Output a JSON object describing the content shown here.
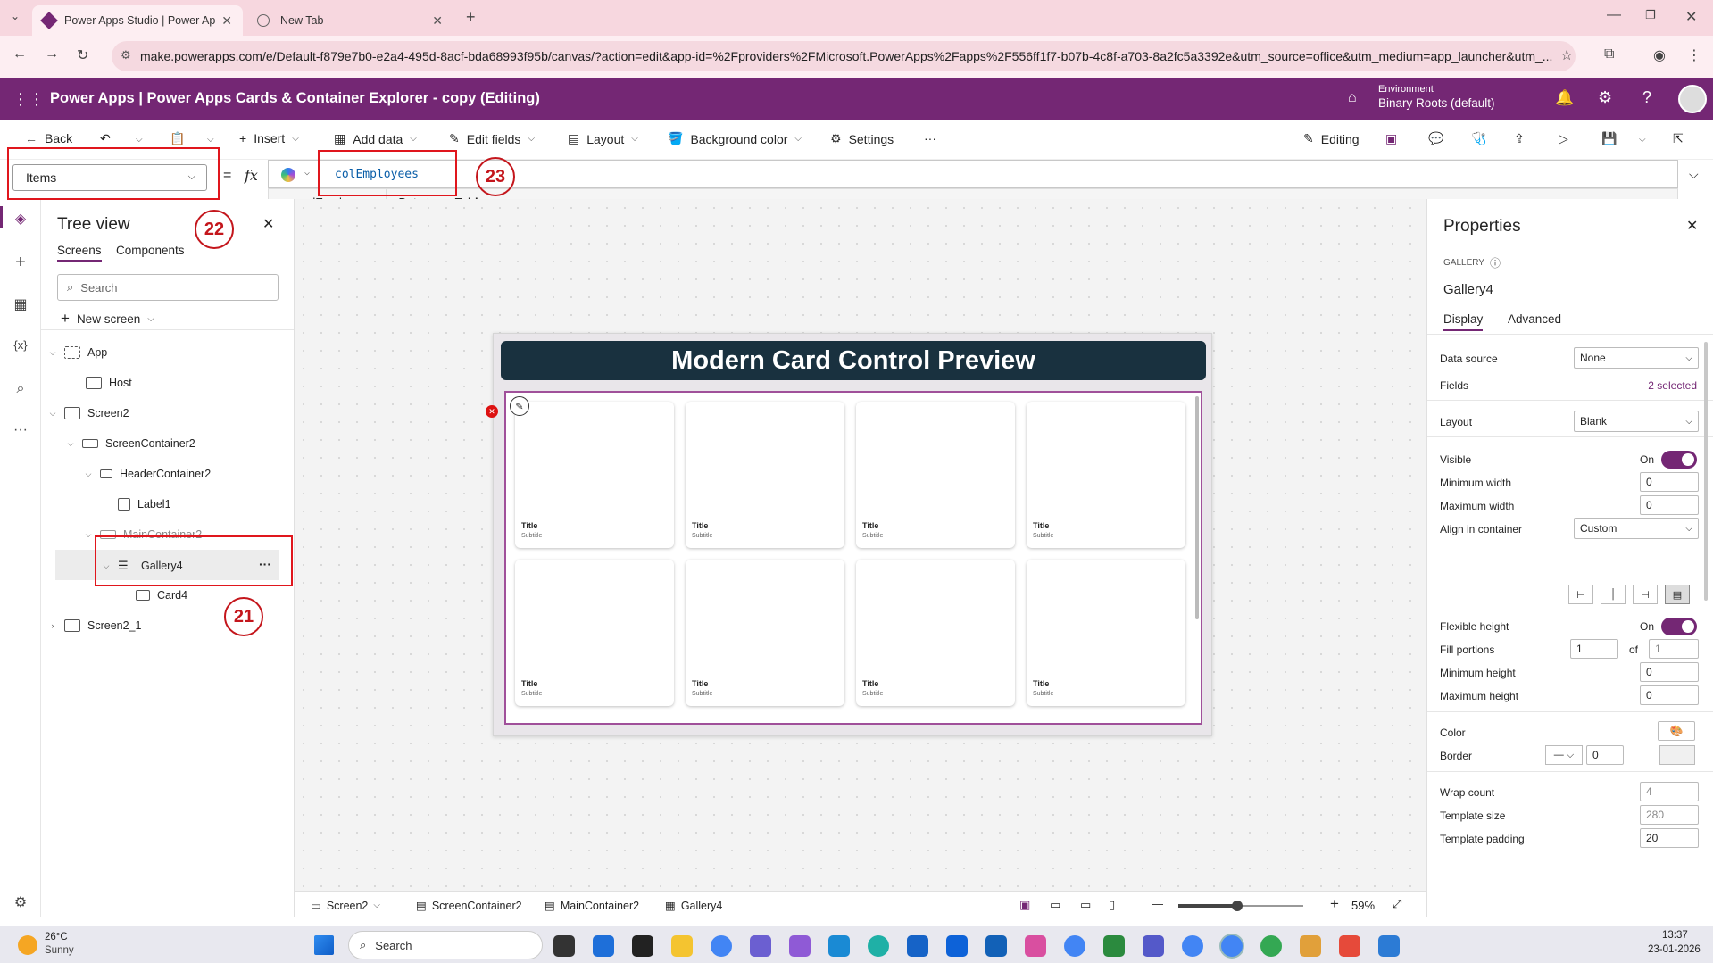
{
  "browser": {
    "tabs": [
      {
        "label": "Power Apps Studio | Power Ap"
      },
      {
        "label": "New Tab"
      }
    ],
    "url": "make.powerapps.com/e/Default-f879e7b0-e2a4-495d-8acf-bda68993f95b/canvas/?action=edit&app-id=%2Fproviders%2FMicrosoft.PowerApps%2Fapps%2F556ff1f7-b07b-4c8f-a703-8a2fc5a3392e&utm_source=office&utm_medium=app_launcher&utm_..."
  },
  "app_header": {
    "title": "Power Apps  |  Power Apps Cards & Container Explorer - copy (Editing)",
    "environment_label": "Environment",
    "environment_name": "Binary Roots (default)"
  },
  "command_bar": {
    "back": "Back",
    "insert": "Insert",
    "add_data": "Add data",
    "edit_fields": "Edit fields",
    "layout": "Layout",
    "background_color": "Background color",
    "settings": "Settings",
    "more": "···",
    "editing": "Editing"
  },
  "formula_bar": {
    "property": "Items",
    "equals": "=",
    "fx": "fx",
    "formula": "colEmployees",
    "hint_name": "colEmployees",
    "hint_type_label": "Data type:",
    "hint_type_value": "Table"
  },
  "tree_view": {
    "title": "Tree view",
    "tabs": [
      "Screens",
      "Components"
    ],
    "search_placeholder": "Search",
    "new_screen": "New screen",
    "nodes": [
      {
        "label": "App"
      },
      {
        "label": "Host"
      },
      {
        "label": "Screen2"
      },
      {
        "label": "ScreenContainer2"
      },
      {
        "label": "HeaderContainer2"
      },
      {
        "label": "Label1"
      },
      {
        "label": "MainContainer2"
      },
      {
        "label": "Gallery4"
      },
      {
        "label": "Card4"
      },
      {
        "label": "Screen2_1"
      }
    ],
    "gallery_more": "···"
  },
  "canvas": {
    "header_text": "Modern Card Control Preview",
    "cards": [
      {
        "title": "Title",
        "subtitle": "Subtitle"
      },
      {
        "title": "Title",
        "subtitle": "Subtitle"
      },
      {
        "title": "Title",
        "subtitle": "Subtitle"
      },
      {
        "title": "Title",
        "subtitle": "Subtitle"
      },
      {
        "title": "Title",
        "subtitle": "Subtitle"
      },
      {
        "title": "Title",
        "subtitle": "Subtitle"
      },
      {
        "title": "Title",
        "subtitle": "Subtitle"
      },
      {
        "title": "Title",
        "subtitle": "Subtitle"
      }
    ]
  },
  "breadcrumbs": [
    "Screen2",
    "ScreenContainer2",
    "MainContainer2",
    "Gallery4"
  ],
  "zoom": "59%",
  "properties": {
    "title": "Properties",
    "kind": "GALLERY",
    "name": "Gallery4",
    "tabs": [
      "Display",
      "Advanced"
    ],
    "data_source_label": "Data source",
    "data_source_value": "None",
    "fields_label": "Fields",
    "fields_value": "2 selected",
    "layout_label": "Layout",
    "layout_value": "Blank",
    "visible_label": "Visible",
    "visible_value": "On",
    "min_width_label": "Minimum width",
    "min_width_value": "0",
    "max_width_label": "Maximum width",
    "max_width_value": "0",
    "align_label": "Align in container",
    "align_value": "Custom",
    "flex_height_label": "Flexible height",
    "flex_height_value": "On",
    "fill_label": "Fill portions",
    "fill_value": "1",
    "fill_of": "of",
    "fill_total": "1",
    "min_height_label": "Minimum height",
    "min_height_value": "0",
    "max_height_label": "Maximum height",
    "max_height_value": "0",
    "color_label": "Color",
    "border_label": "Border",
    "border_value": "0",
    "wrap_label": "Wrap count",
    "wrap_value": "4",
    "template_size_label": "Template size",
    "template_size_value": "280",
    "template_padding_label": "Template padding",
    "template_padding_value": "20"
  },
  "annotations": [
    "21",
    "22",
    "23"
  ],
  "taskbar": {
    "weather_temp": "26°C",
    "weather_desc": "Sunny",
    "search_placeholder": "Search",
    "time": "13:37",
    "date": "23-01-2026"
  },
  "colors": {
    "brand_purple": "#742774",
    "header_dark": "#19313f",
    "annotation_red": "#e0161d"
  }
}
